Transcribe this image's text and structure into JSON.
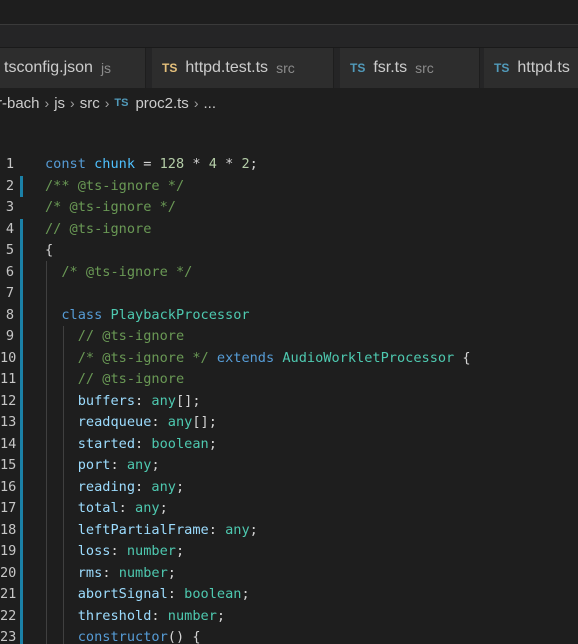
{
  "tabs": [
    {
      "icon": "",
      "name": "tsconfig.json",
      "desc": "js"
    },
    {
      "icon": "TS",
      "name": "httpd.test.ts",
      "desc": "src"
    },
    {
      "icon": "TS",
      "name": "fsr.ts",
      "desc": "src"
    },
    {
      "icon": "TS",
      "name": "httpd.ts",
      "desc": ""
    }
  ],
  "breadcrumb": {
    "part1": "r-bach",
    "part2": "js",
    "part3": "src",
    "file_icon": "TS",
    "file": "proc2.ts",
    "ellipsis": "..."
  },
  "lines": [
    {
      "n": "1",
      "t": [
        [
          "kw",
          "const"
        ],
        [
          "",
          " "
        ],
        [
          "kw2",
          "chunk"
        ],
        [
          "",
          " = "
        ],
        [
          "num",
          "128"
        ],
        [
          "",
          " * "
        ],
        [
          "num",
          "4"
        ],
        [
          "",
          " * "
        ],
        [
          "num",
          "2"
        ],
        [
          "",
          ";"
        ]
      ]
    },
    {
      "n": "2",
      "t": [
        [
          "cmt",
          "/** @ts-ignore */"
        ]
      ]
    },
    {
      "n": "3",
      "t": [
        [
          "cmt",
          "/* @ts-ignore */"
        ]
      ]
    },
    {
      "n": "4",
      "t": [
        [
          "cmt",
          "// @ts-ignore"
        ]
      ]
    },
    {
      "n": "5",
      "t": [
        [
          "",
          "{"
        ]
      ]
    },
    {
      "n": "6",
      "t": [
        [
          "",
          "  "
        ],
        [
          "cmt",
          "/* @ts-ignore */"
        ]
      ]
    },
    {
      "n": "7",
      "t": []
    },
    {
      "n": "8",
      "t": [
        [
          "",
          "  "
        ],
        [
          "kw",
          "class"
        ],
        [
          "",
          " "
        ],
        [
          "cls",
          "PlaybackProcessor"
        ]
      ]
    },
    {
      "n": "9",
      "t": [
        [
          "",
          "    "
        ],
        [
          "cmt",
          "// @ts-ignore"
        ]
      ]
    },
    {
      "n": "10",
      "t": [
        [
          "",
          "    "
        ],
        [
          "cmt",
          "/* @ts-ignore */"
        ],
        [
          "",
          " "
        ],
        [
          "kw",
          "extends"
        ],
        [
          "",
          " "
        ],
        [
          "cls",
          "AudioWorkletProcessor"
        ],
        [
          "",
          " {"
        ]
      ]
    },
    {
      "n": "11",
      "t": [
        [
          "",
          "    "
        ],
        [
          "cmt",
          "// @ts-ignore"
        ]
      ]
    },
    {
      "n": "12",
      "t": [
        [
          "",
          "    "
        ],
        [
          "prop",
          "buffers"
        ],
        [
          "",
          ": "
        ],
        [
          "cls",
          "any"
        ],
        [
          "",
          "[];"
        ]
      ]
    },
    {
      "n": "13",
      "t": [
        [
          "",
          "    "
        ],
        [
          "prop",
          "readqueue"
        ],
        [
          "",
          ": "
        ],
        [
          "cls",
          "any"
        ],
        [
          "",
          "[];"
        ]
      ]
    },
    {
      "n": "14",
      "t": [
        [
          "",
          "    "
        ],
        [
          "prop",
          "started"
        ],
        [
          "",
          ": "
        ],
        [
          "cls",
          "boolean"
        ],
        [
          "",
          ";"
        ]
      ]
    },
    {
      "n": "15",
      "t": [
        [
          "",
          "    "
        ],
        [
          "prop",
          "port"
        ],
        [
          "",
          ": "
        ],
        [
          "cls",
          "any"
        ],
        [
          "",
          ";"
        ]
      ]
    },
    {
      "n": "16",
      "t": [
        [
          "",
          "    "
        ],
        [
          "prop",
          "reading"
        ],
        [
          "",
          ": "
        ],
        [
          "cls",
          "any"
        ],
        [
          "",
          ";"
        ]
      ]
    },
    {
      "n": "17",
      "t": [
        [
          "",
          "    "
        ],
        [
          "prop",
          "total"
        ],
        [
          "",
          ": "
        ],
        [
          "cls",
          "any"
        ],
        [
          "",
          ";"
        ]
      ]
    },
    {
      "n": "18",
      "t": [
        [
          "",
          "    "
        ],
        [
          "prop",
          "leftPartialFrame"
        ],
        [
          "",
          ": "
        ],
        [
          "cls",
          "any"
        ],
        [
          "",
          ";"
        ]
      ]
    },
    {
      "n": "19",
      "t": [
        [
          "",
          "    "
        ],
        [
          "prop",
          "loss"
        ],
        [
          "",
          ": "
        ],
        [
          "cls",
          "number"
        ],
        [
          "",
          ";"
        ]
      ]
    },
    {
      "n": "20",
      "t": [
        [
          "",
          "    "
        ],
        [
          "prop",
          "rms"
        ],
        [
          "",
          ": "
        ],
        [
          "cls",
          "number"
        ],
        [
          "",
          ";"
        ]
      ]
    },
    {
      "n": "21",
      "t": [
        [
          "",
          "    "
        ],
        [
          "prop",
          "abortSignal"
        ],
        [
          "",
          ": "
        ],
        [
          "cls",
          "boolean"
        ],
        [
          "",
          ";"
        ]
      ]
    },
    {
      "n": "22",
      "t": [
        [
          "",
          "    "
        ],
        [
          "prop",
          "threshold"
        ],
        [
          "",
          ": "
        ],
        [
          "cls",
          "number"
        ],
        [
          "",
          ";"
        ]
      ]
    },
    {
      "n": "23",
      "t": [
        [
          "",
          "    "
        ],
        [
          "kw",
          "constructor"
        ],
        [
          "",
          "() {"
        ]
      ]
    }
  ],
  "modified_lines": [
    "2",
    "4",
    "5",
    "6",
    "7",
    "8",
    "9",
    "10",
    "11",
    "12",
    "13",
    "14",
    "15",
    "16",
    "17",
    "18",
    "19",
    "20",
    "21",
    "22",
    "23"
  ],
  "colors": {
    "background": "#1e1e1e",
    "keyword": "#569cd6",
    "comment": "#6a9955",
    "type": "#4ec9b0",
    "property": "#9cdcfe",
    "number": "#b5cea8",
    "modified_gutter": "#1b81a8"
  }
}
